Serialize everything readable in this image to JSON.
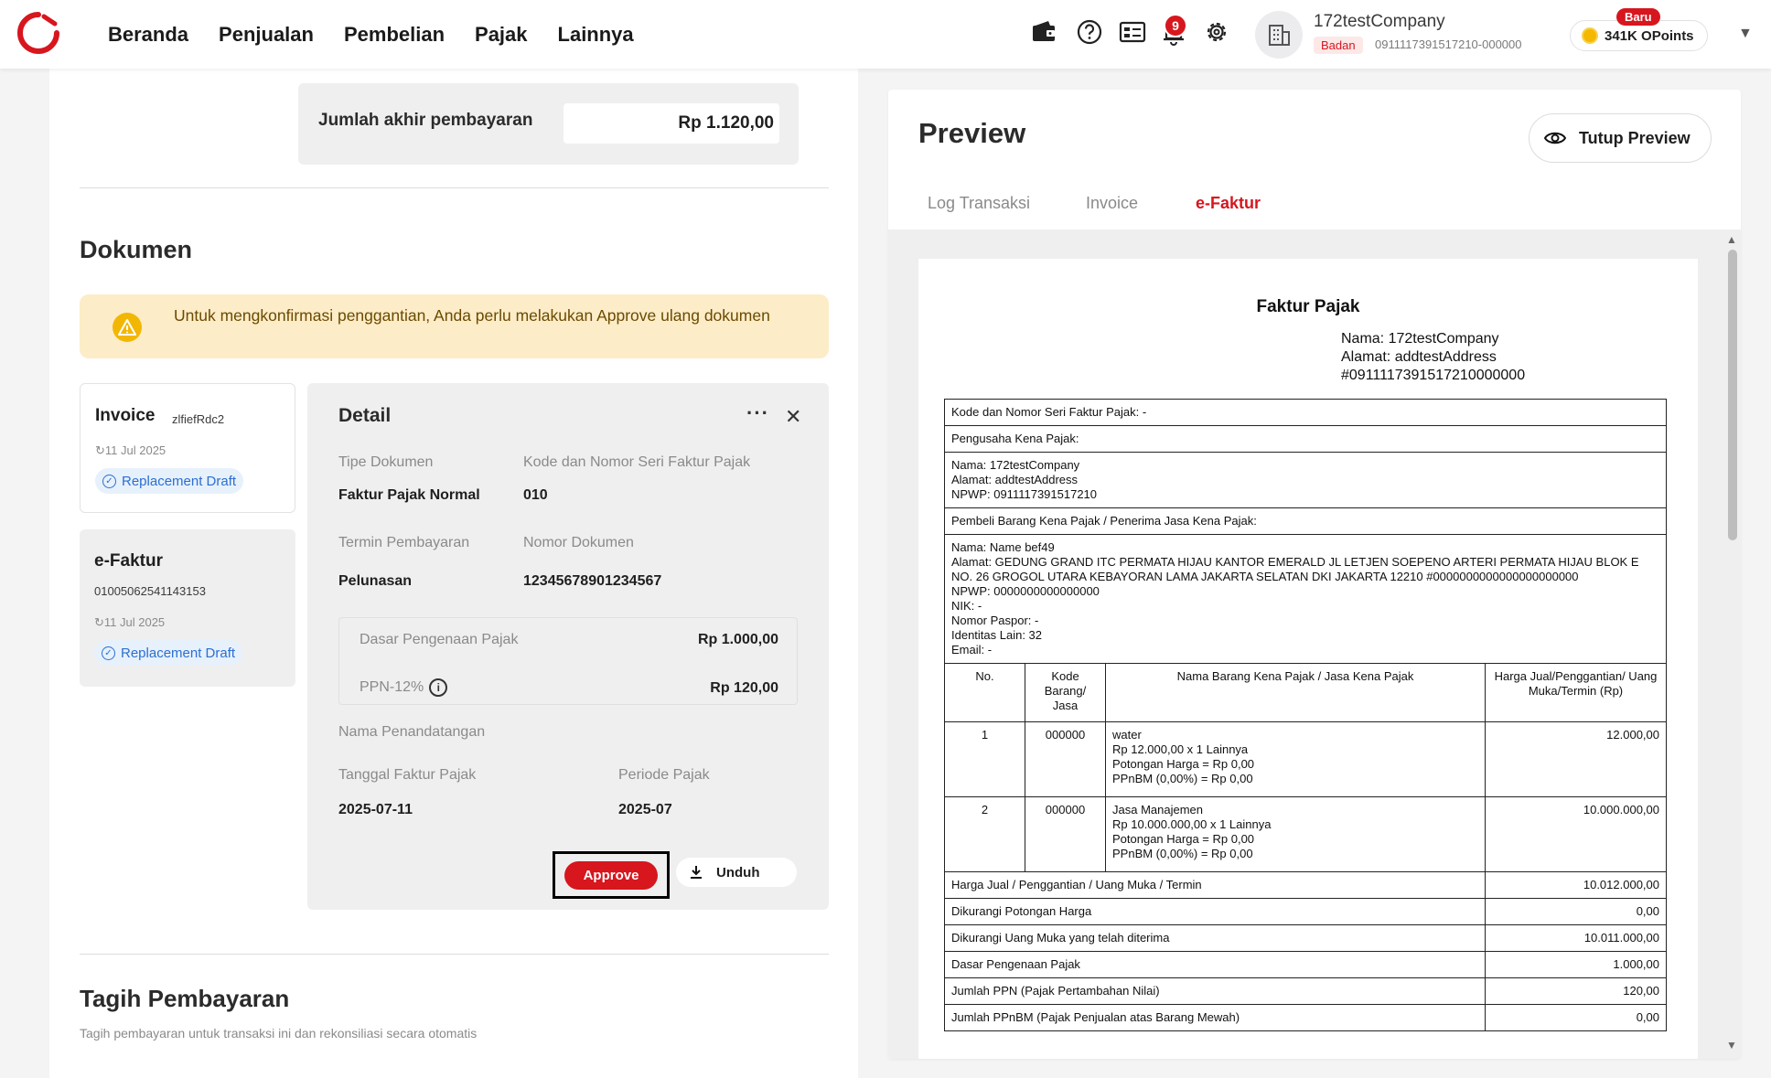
{
  "colors": {
    "brand": "#d7161e",
    "warning_bg": "#fdecc8",
    "info": "#2b6fd1"
  },
  "nav": [
    "Beranda",
    "Penjualan",
    "Pembelian",
    "Pajak",
    "Lainnya"
  ],
  "topbar": {
    "icons": [
      "wallet-icon",
      "help-icon",
      "document-list-icon",
      "notification-bell-icon",
      "settings-gear-icon"
    ],
    "notification_count": "9",
    "company_name": "172testCompany",
    "entity_type": "Badan",
    "npwp": "0911117391517210-000000",
    "points_badge": "Baru",
    "points": "341K OPoints"
  },
  "payment": {
    "label": "Jumlah akhir pembayaran",
    "value": "Rp 1.120,00"
  },
  "dokumen": {
    "title": "Dokumen",
    "warning": "Untuk mengkonfirmasi penggantian, Anda perlu melakukan Approve ulang dokumen",
    "cards": [
      {
        "title": "Invoice",
        "sub": "zlfiefRdc2",
        "date": "11 Jul 2025",
        "status": "Replacement Draft"
      },
      {
        "title": "e-Faktur",
        "sub": "01005062541143153",
        "date": "11 Jul 2025",
        "status": "Replacement Draft"
      }
    ]
  },
  "detail": {
    "title": "Detail",
    "tipe_label": "Tipe Dokumen",
    "tipe_value": "Faktur Pajak Normal",
    "kode_label": "Kode dan Nomor Seri Faktur Pajak",
    "kode_value": "010",
    "termin_label": "Termin Pembayaran",
    "termin_value": "Pelunasan",
    "nomor_label": "Nomor Dokumen",
    "nomor_value": "12345678901234567",
    "dpp_label": "Dasar Pengenaan Pajak",
    "dpp_value": "Rp 1.000,00",
    "ppn_label": "PPN-12%",
    "ppn_value": "Rp 120,00",
    "penandatangan_label": "Nama Penandatangan",
    "tanggal_label": "Tanggal Faktur Pajak",
    "tanggal_value": "2025-07-11",
    "periode_label": "Periode Pajak",
    "periode_value": "2025-07",
    "approve_label": "Approve",
    "unduh_label": "Unduh"
  },
  "tagih": {
    "title": "Tagih Pembayaran",
    "subtitle": "Tagih pembayaran untuk transaksi ini dan rekonsiliasi secara otomatis"
  },
  "preview": {
    "title": "Preview",
    "close_label": "Tutup Preview",
    "tabs": [
      "Log Transaksi",
      "Invoice",
      "e-Faktur"
    ],
    "active_tab": "e-Faktur"
  },
  "faktur": {
    "title": "Faktur Pajak",
    "nama": "Nama: 172testCompany",
    "alamat": "Alamat: addtestAddress",
    "npwp": "#0911117391517210000000",
    "kode_seri": "Kode dan Nomor Seri Faktur Pajak: -",
    "pengusaha": "Pengusaha Kena Pajak:",
    "pkp_nama": "Nama: 172testCompany",
    "pkp_alamat": "Alamat: addtestAddress",
    "pkp_npwp": "NPWP: 0911117391517210",
    "pembeli": "Pembeli Barang Kena Pajak / Penerima Jasa Kena Pajak:",
    "buyer_nama": "Nama: Name bef49",
    "buyer_alamat": "Alamat: GEDUNG GRAND ITC PERMATA HIJAU KANTOR EMERALD JL LETJEN SOEPENO ARTERI PERMATA HIJAU BLOK E NO. 26 GROGOL UTARA KEBAYORAN LAMA JAKARTA SELATAN DKI JAKARTA 12210 #0000000000000000000000",
    "buyer_npwp": "NPWP: 0000000000000000",
    "buyer_nik": "NIK: -",
    "buyer_paspor": "Nomor Paspor: -",
    "buyer_identitas": "Identitas Lain: 32",
    "buyer_email": "Email: -",
    "col_no": "No.",
    "col_kode": "Kode Barang/ Jasa",
    "col_nama": "Nama Barang Kena Pajak / Jasa Kena Pajak",
    "col_harga": "Harga Jual/Penggantian/ Uang Muka/Termin (Rp)",
    "items": [
      {
        "no": "1",
        "kode": "000000",
        "l1": "water",
        "l2": "Rp 12.000,00 x 1 Lainnya",
        "l3": "Potongan Harga = Rp 0,00",
        "l4": "PPnBM (0,00%) = Rp 0,00",
        "harga": "12.000,00"
      },
      {
        "no": "2",
        "kode": "000000",
        "l1": "Jasa Manajemen",
        "l2": "Rp 10.000.000,00 x 1 Lainnya",
        "l3": "Potongan Harga = Rp 0,00",
        "l4": "PPnBM (0,00%) = Rp 0,00",
        "harga": "10.000.000,00"
      }
    ],
    "summary": [
      {
        "label": "Harga Jual / Penggantian / Uang Muka / Termin",
        "value": "10.012.000,00"
      },
      {
        "label": "Dikurangi Potongan Harga",
        "value": "0,00"
      },
      {
        "label": "Dikurangi Uang Muka yang telah diterima",
        "value": "10.011.000,00"
      },
      {
        "label": "Dasar Pengenaan Pajak",
        "value": "1.000,00"
      },
      {
        "label": "Jumlah PPN (Pajak Pertambahan Nilai)",
        "value": "120,00"
      },
      {
        "label": "Jumlah PPnBM (Pajak Penjualan atas Barang Mewah)",
        "value": "0,00"
      }
    ]
  }
}
